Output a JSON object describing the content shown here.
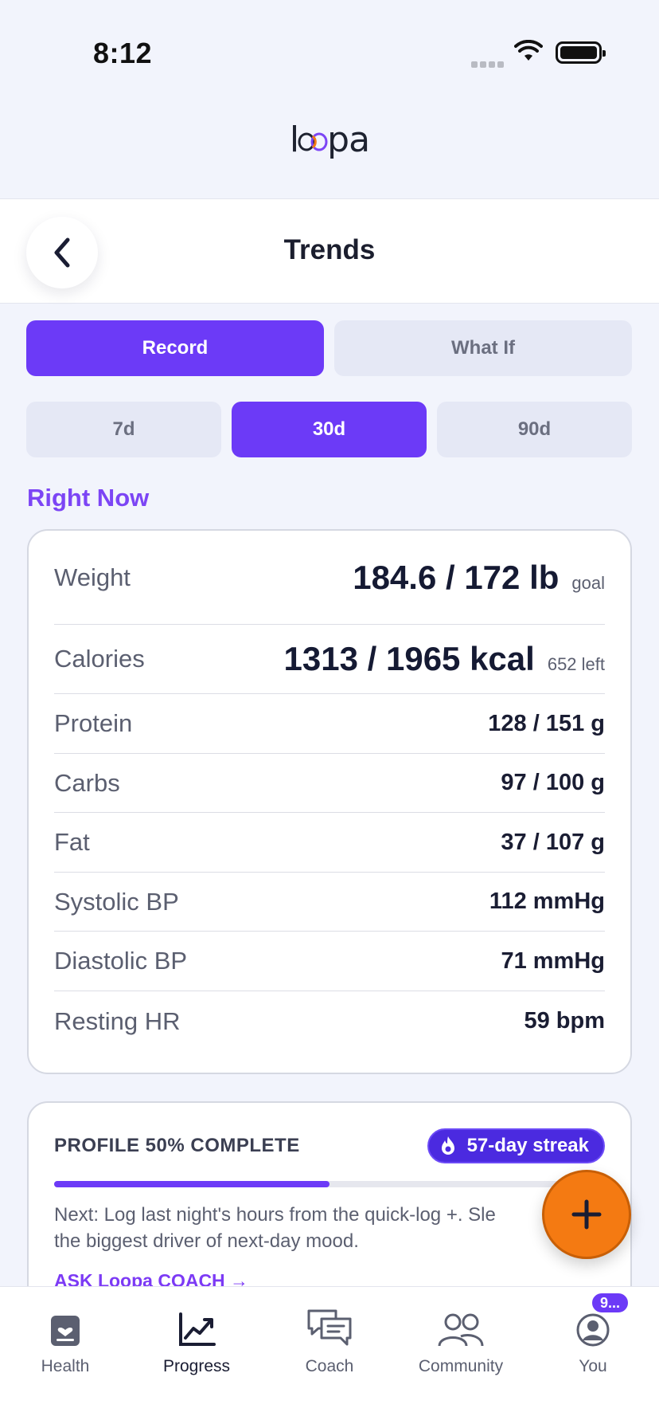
{
  "status_bar": {
    "time": "8:12"
  },
  "brand": {
    "logo_left": "l",
    "logo_right": "pa",
    "logo_text": "loopa"
  },
  "header": {
    "title": "Trends",
    "back_icon": "chevron-left-icon"
  },
  "mode_tabs": [
    {
      "label": "Record",
      "active": true
    },
    {
      "label": "What If",
      "active": false
    }
  ],
  "range_tabs": [
    {
      "label": "7d",
      "active": false
    },
    {
      "label": "30d",
      "active": true
    },
    {
      "label": "90d",
      "active": false
    }
  ],
  "right_now": {
    "title": "Right Now",
    "rows": [
      {
        "label": "Weight",
        "value": "184.6 / 172 lb",
        "suffix": "goal"
      },
      {
        "label": "Calories",
        "value": "1313 / 1965 kcal",
        "suffix": "652 left"
      },
      {
        "label": "Protein",
        "value": "128 / 151 g"
      },
      {
        "label": "Carbs",
        "value": "97 / 100 g"
      },
      {
        "label": "Fat",
        "value": "37 / 107 g"
      },
      {
        "label": "Systolic BP",
        "value": "112 mmHg"
      },
      {
        "label": "Diastolic BP",
        "value": "71 mmHg"
      },
      {
        "label": "Resting HR",
        "value": "59 bpm"
      }
    ]
  },
  "profile": {
    "title": "PROFILE 50% COMPLETE",
    "progress_percent": 50,
    "streak_label": "57-day streak",
    "streak_icon": "flame-icon",
    "next_line1": "Next: Log last night's hours from the quick-log +. Sle",
    "next_line2": "the biggest driver of next-day mood.",
    "coach_link": "ASK Loopa COACH →"
  },
  "fab": {
    "icon": "plus-icon"
  },
  "tabbar": {
    "items": [
      {
        "label": "Health",
        "icon": "health-icon",
        "active": false
      },
      {
        "label": "Progress",
        "icon": "chart-icon",
        "active": true
      },
      {
        "label": "Coach",
        "icon": "chat-icon",
        "active": false
      },
      {
        "label": "Community",
        "icon": "people-icon",
        "active": false
      },
      {
        "label": "You",
        "icon": "profile-icon",
        "active": false
      }
    ],
    "you_badge": "9..."
  },
  "colors": {
    "accent": "#6c3af7",
    "fab": "#f47a12",
    "section_title": "#7c45f5"
  }
}
